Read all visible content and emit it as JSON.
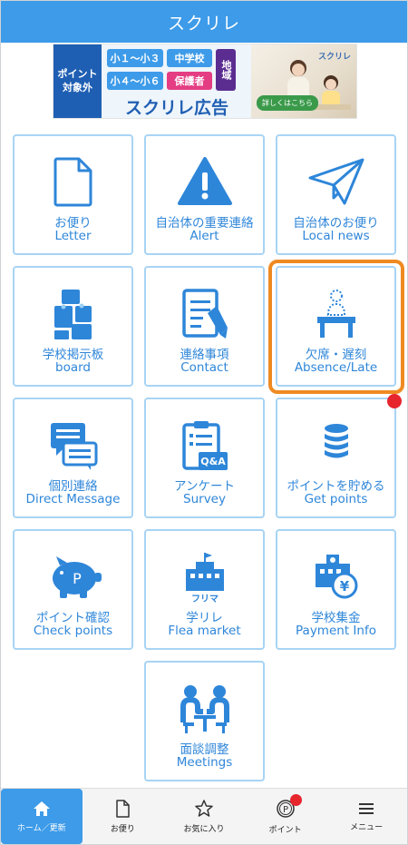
{
  "header": {
    "title": "スクリレ"
  },
  "ad": {
    "left_label": "ポイント対象外",
    "chips": [
      "小１～小３",
      "中学校",
      "地域",
      "小４～小６",
      "保護者"
    ],
    "title": "スクリレ広告",
    "logo": "スクリレ",
    "cta": "詳しくはこちら"
  },
  "tiles": [
    {
      "jp": "お便り",
      "en": "Letter",
      "icon": "document-icon"
    },
    {
      "jp": "自治体の重要連絡",
      "en": "Alert",
      "icon": "warning-icon"
    },
    {
      "jp": "自治体のお便り",
      "en": "Local news",
      "icon": "paper-plane-icon"
    },
    {
      "jp": "学校掲示板",
      "en": "board",
      "icon": "bulletin-board-icon"
    },
    {
      "jp": "連絡事項",
      "en": "Contact",
      "icon": "memo-pen-icon"
    },
    {
      "jp": "欠席・遅刻",
      "en": "Absence/Late",
      "icon": "empty-desk-icon"
    },
    {
      "jp": "個別連絡",
      "en": "Direct Message",
      "icon": "chat-bubbles-icon"
    },
    {
      "jp": "アンケート",
      "en": "Survey",
      "icon": "survey-clipboard-icon",
      "badge": "Q&A"
    },
    {
      "jp": "ポイントを貯める",
      "en": "Get points",
      "icon": "coin-stack-icon"
    },
    {
      "jp": "ポイント確認",
      "en": "Check points",
      "icon": "piggy-bank-icon",
      "badge": "P"
    },
    {
      "jp": "学リレ",
      "en": "Flea market",
      "icon": "school-building-icon",
      "badge": "フリマ"
    },
    {
      "jp": "学校集金",
      "en": "Payment Info",
      "icon": "school-yen-icon",
      "badge": "¥"
    },
    {
      "jp": "面談調整",
      "en": "Meetings",
      "icon": "meeting-icon"
    }
  ],
  "bottom_nav": [
    {
      "label": "ホーム／更新",
      "icon": "home-icon",
      "active": true
    },
    {
      "label": "お便り",
      "icon": "document-icon",
      "active": false
    },
    {
      "label": "お気に入り",
      "icon": "star-icon",
      "active": false
    },
    {
      "label": "ポイント",
      "icon": "point-coin-icon",
      "active": false,
      "badge": "P"
    },
    {
      "label": "メニュー",
      "icon": "menu-icon",
      "active": false
    }
  ],
  "colors": {
    "brand": "#3d9be9",
    "tile_text": "#2e86d9",
    "tile_border": "#a8d4f4",
    "highlight": "#ef8a22",
    "notification": "#e6252d"
  }
}
